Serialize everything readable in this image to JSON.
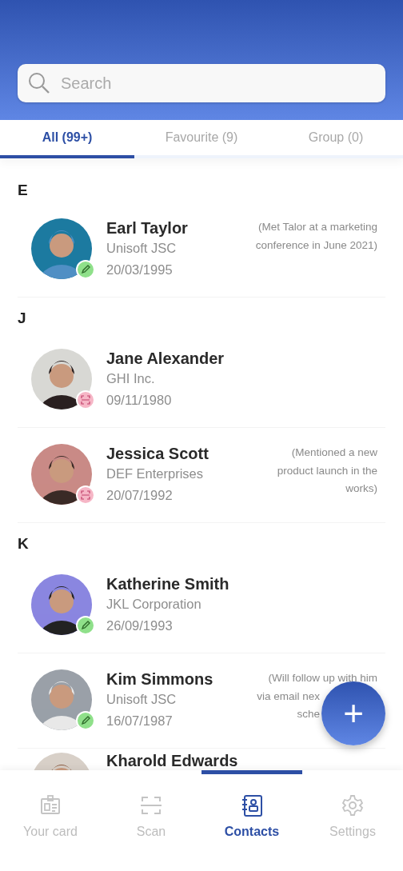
{
  "search": {
    "placeholder": "Search"
  },
  "tabs": [
    {
      "label": "All (99+)",
      "selected": true
    },
    {
      "label": "Favourite (9)",
      "selected": false
    },
    {
      "label": "Group (0)",
      "selected": false
    }
  ],
  "sections": [
    {
      "letter": "E",
      "contacts": [
        {
          "name": "Earl Taylor",
          "company": "Unisoft JSC",
          "date": "20/03/1995",
          "badge": {
            "kind": "edit"
          },
          "note": {
            "lines": [
              "(Met Talor at a marketing",
              "conference in June 2021)"
            ]
          }
        }
      ]
    },
    {
      "letter": "J",
      "contacts": [
        {
          "name": "Jane Alexander",
          "company": "GHI Inc.",
          "date": "09/11/1980",
          "badge": {
            "kind": "scan"
          }
        },
        {
          "name": "Jessica Scott",
          "company": "DEF Enterprises",
          "date": "20/07/1992",
          "badge": {
            "kind": "scan"
          },
          "note": {
            "lines": [
              "(Mentioned a new",
              "product launch in the",
              "works)"
            ]
          }
        }
      ]
    },
    {
      "letter": "K",
      "contacts": [
        {
          "name": "Katherine Smith",
          "company": "JKL Corporation",
          "date": "26/09/1993",
          "badge": {
            "kind": "edit"
          }
        },
        {
          "name": "Kim Simmons",
          "company": "Unisoft JSC",
          "date": "16/07/1987",
          "badge": {
            "kind": "edit"
          },
          "note": {
            "lines": [
              "(Will follow up with him",
              "via email nex",
              "sche"
            ],
            "covered": true
          }
        },
        {
          "name": "Kharold Edwards"
        }
      ]
    }
  ],
  "fab": {
    "label": "+"
  },
  "nav": [
    {
      "label": "Your card",
      "selected": false
    },
    {
      "label": "Scan",
      "selected": false
    },
    {
      "label": "Contacts",
      "selected": true
    },
    {
      "label": "Settings",
      "selected": false
    }
  ]
}
